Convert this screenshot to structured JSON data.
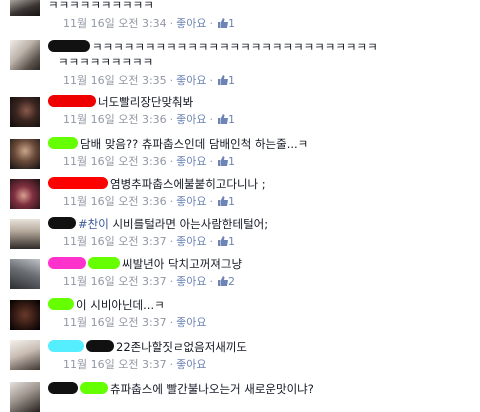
{
  "comments": [
    {
      "text": "ㅋㅋㅋㅋㅋㅋㅋㅋㅋㅋ",
      "text2": "",
      "time": "11월 16일 오전 3:34",
      "like_label": "좋아요",
      "likes": "1",
      "avatar": "av-a"
    },
    {
      "text": "ㅋㅋㅋㅋㅋㅋㅋㅋㅋㅋㅋㅋㅋㅋㅋㅋㅋㅋㅋㅋㅋㅋㅋㅋㅋㅋㅋ",
      "text2": "ㅋㅋㅋㅋㅋㅋㅋㅋㅋ",
      "time": "11월 16일 오전 3:35",
      "like_label": "좋아요",
      "likes": "1",
      "avatar": "av-b"
    },
    {
      "text": "너도빨리장단맞춰봐",
      "text2": "",
      "time": "11월 16일 오전 3:36",
      "like_label": "좋아요",
      "likes": "1",
      "avatar": "av-c"
    },
    {
      "text": "담배 맞음?? 츄파춥스인데 담배인척 하는줄...ㅋ",
      "text2": "",
      "time": "11월 16일 오전 3:36",
      "like_label": "좋아요",
      "likes": "1",
      "avatar": "av-d"
    },
    {
      "text": "염병추파춥스에불붙히고다니나 ;",
      "text2": "",
      "time": "11월 16일 오전 3:36",
      "like_label": "좋아요",
      "likes": "1",
      "avatar": "av-e"
    },
    {
      "tag": "#찬이",
      "text": " 시비를털라면 아는사람한테털어;",
      "text2": "",
      "time": "11월 16일 오전 3:37",
      "like_label": "좋아요",
      "likes": "1",
      "avatar": "av-f"
    },
    {
      "text": "씨발년아 닥치고꺼져그냥",
      "text2": "",
      "time": "11월 16일 오전 3:37",
      "like_label": "좋아요",
      "likes": "2",
      "avatar": "av-g"
    },
    {
      "text": "이 시비아닌데...ㅋ",
      "text2": "",
      "time": "11월 16일 오전 3:37",
      "like_label": "좋아요",
      "likes": "",
      "avatar": "av-h"
    },
    {
      "text": "22존나할짓ㄹ없음저새끼도",
      "text2": "",
      "time": "11월 16일 오전 3:37",
      "like_label": "좋아요",
      "likes": "",
      "avatar": "av-i"
    },
    {
      "text": "츄파춥스에 빨간불나오는거 새로운맛이냐?",
      "text2": "",
      "time": "",
      "like_label": "",
      "likes": "",
      "avatar": "av-j"
    }
  ],
  "colors": {
    "meta": "#9197a3",
    "link": "#6d84b4",
    "tag": "#3b5998"
  }
}
